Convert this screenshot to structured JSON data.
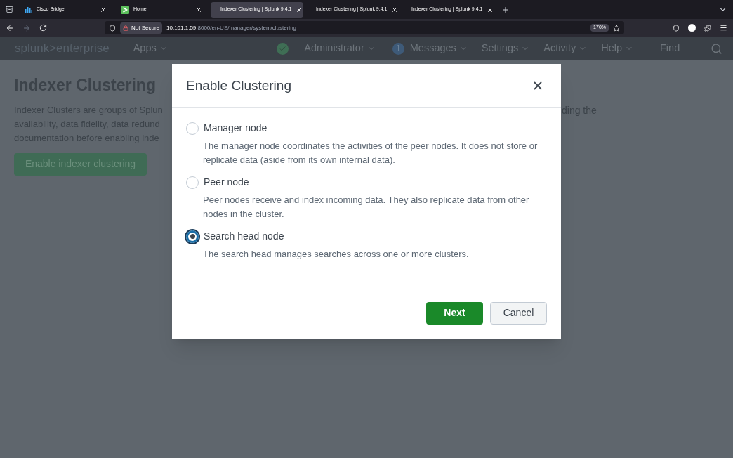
{
  "browser": {
    "tabs": [
      {
        "title": "Cisco Bridge",
        "kind": "bars",
        "selected": false
      },
      {
        "title": "Home",
        "kind": "splunk",
        "selected": false
      },
      {
        "title": "Indexer Clustering | Splunk 9.4.1",
        "kind": "splunk",
        "selected": true
      },
      {
        "title": "Indexer Clustering | Splunk 9.4.1",
        "kind": "splunk",
        "selected": false
      },
      {
        "title": "Indexer Clustering | Splunk 9.4.1",
        "kind": "splunk",
        "selected": false
      }
    ],
    "security": "Not Secure",
    "host": "10.101.1.59",
    "path": ":8000/en-US/manager/system/clustering",
    "zoom": "170%"
  },
  "navbar": {
    "logo_left": "splunk>",
    "logo_right": "enterprise",
    "apps": "Apps",
    "user": "Administrator",
    "messages_count": "1",
    "messages": "Messages",
    "menus": [
      "Settings",
      "Activity",
      "Help"
    ],
    "search_placeholder": "Find"
  },
  "page": {
    "title": "Indexer Clustering",
    "description_left": [
      "Indexer Clusters are groups of Splun",
      "availability, data fidelity, data redund",
      "documentation before enabling inde"
    ],
    "description_right": [
      "ding the"
    ],
    "button": "Enable indexer clustering"
  },
  "dialog": {
    "title": "Enable Clustering",
    "options": [
      {
        "label": "Manager node",
        "description": "The manager node coordinates the activities of the peer nodes. It does not store or replicate data (aside from its own internal data).",
        "selected": false
      },
      {
        "label": "Peer node",
        "description": "Peer nodes receive and index incoming data. They also replicate data from other nodes in the cluster.",
        "selected": false
      },
      {
        "label": "Search head node",
        "description": "The search head manages searches across one or more clusters.",
        "selected": true
      }
    ],
    "primary": "Next",
    "secondary": "Cancel"
  }
}
